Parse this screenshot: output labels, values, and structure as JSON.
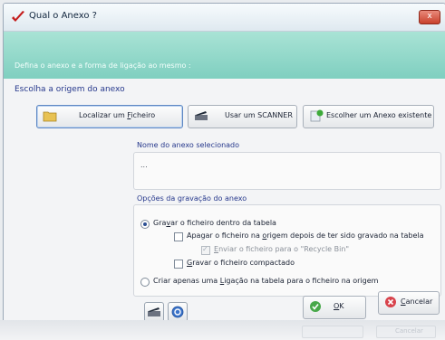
{
  "window": {
    "title": "Qual o Anexo ?",
    "close_label": "x"
  },
  "banner": {
    "text": "Defina o anexo e a forma de ligação ao mesmo :"
  },
  "source_section": {
    "title": "Escolha a origem do anexo"
  },
  "buttons": {
    "locate": {
      "prefix": "Localizar um ",
      "accel": "F",
      "suffix": "icheiro",
      "icon": "folder-icon"
    },
    "scanner": {
      "label": "Usar um SCANNER",
      "icon": "scanner-icon"
    },
    "existing": {
      "label": "Escolher um Anexo existente",
      "icon": "attachment-icon"
    }
  },
  "selected": {
    "label": "Nome do anexo selecionado",
    "value": "..."
  },
  "options": {
    "title": "Opções da gravação do anexo",
    "save_in_table": {
      "pre": "Gra",
      "accel": "v",
      "post": "ar o ficheiro dentro da tabela",
      "checked": true
    },
    "delete_origin": {
      "pre": "Apagar o ficheiro na ",
      "accel": "o",
      "post": "rigem depois de ter sido gravado na tabela",
      "checked": false
    },
    "recycle_bin": {
      "pre": "",
      "accel": "E",
      "post": "nviar o ficheiro para o \"Recycle Bin\"",
      "checked": true,
      "disabled": true
    },
    "compressed": {
      "pre": "",
      "accel": "G",
      "post": "ravar o ficheiro compactado",
      "checked": false
    },
    "link_only": {
      "pre": "Criar apenas uma ",
      "accel": "L",
      "post": "igação na tabela para o ficheiro na origem",
      "checked": false
    }
  },
  "footer": {
    "ok": {
      "accel": "O",
      "post": "K"
    },
    "cancel": {
      "accel": "C",
      "post": "ancelar"
    },
    "ghost_cancel": "Cancelar"
  }
}
